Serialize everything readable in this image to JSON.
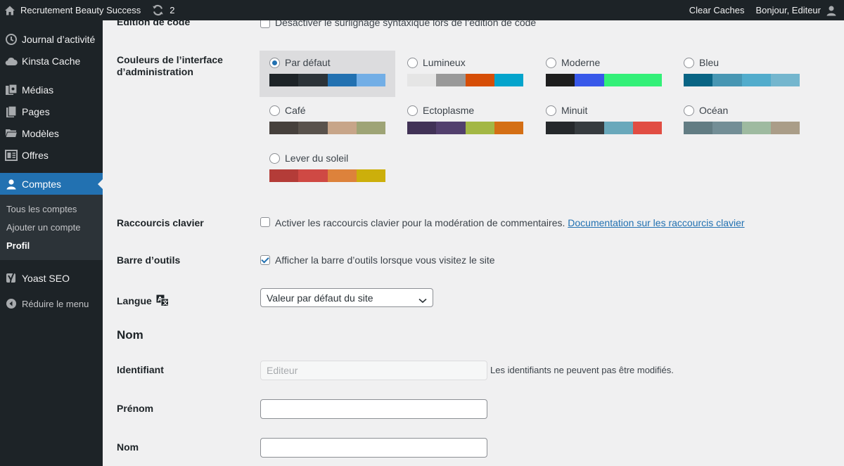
{
  "admin_bar": {
    "site_name": "Recrutement Beauty Success",
    "updates_count": "2",
    "clear_caches": "Clear Caches",
    "greeting": "Bonjour, Editeur"
  },
  "sidebar": {
    "items": [
      {
        "label": "Journal d’activité",
        "icon": "activity-log-icon"
      },
      {
        "label": "Kinsta Cache",
        "icon": "cloud-icon"
      },
      {
        "label": "Médias",
        "icon": "media-icon"
      },
      {
        "label": "Pages",
        "icon": "pages-icon"
      },
      {
        "label": "Modèles",
        "icon": "folder-icon"
      },
      {
        "label": "Offres",
        "icon": "offers-icon"
      },
      {
        "label": "Comptes",
        "icon": "user-icon"
      }
    ],
    "submenu": [
      "Tous les comptes",
      "Ajouter un compte",
      "Profil"
    ],
    "yoast": "Yoast SEO",
    "collapse": "Réduire le menu"
  },
  "form": {
    "code_edit_label": "Édition de code",
    "code_edit_checkbox": "Désactiver le surlignage syntaxique lors de l’édition de code",
    "color_scheme_label_1": "Couleurs de l’interface",
    "color_scheme_label_2": "d’administration",
    "schemes": [
      {
        "name": "Par défaut",
        "selected": true,
        "colors": [
          "#1d2327",
          "#2c3338",
          "#2271b1",
          "#72aee6"
        ]
      },
      {
        "name": "Lumineux",
        "selected": false,
        "colors": [
          "#e5e5e5",
          "#999999",
          "#d64e07",
          "#04a4cc"
        ]
      },
      {
        "name": "Moderne",
        "selected": false,
        "colors": [
          "#1e1e1e",
          "#3858e9",
          "#33f078",
          "#33f078"
        ]
      },
      {
        "name": "Bleu",
        "selected": false,
        "colors": [
          "#096484",
          "#4796b3",
          "#52accc",
          "#74b6ce"
        ]
      },
      {
        "name": "Café",
        "selected": false,
        "colors": [
          "#46403c",
          "#59524c",
          "#c7a589",
          "#9ea476"
        ]
      },
      {
        "name": "Ectoplasme",
        "selected": false,
        "colors": [
          "#413256",
          "#523f6d",
          "#a3b745",
          "#d46f15"
        ]
      },
      {
        "name": "Minuit",
        "selected": false,
        "colors": [
          "#25282b",
          "#363b3f",
          "#69a8bb",
          "#e14d43"
        ]
      },
      {
        "name": "Océan",
        "selected": false,
        "colors": [
          "#627c83",
          "#738e96",
          "#9ebaa0",
          "#aa9d88"
        ]
      },
      {
        "name": "Lever du soleil",
        "selected": false,
        "colors": [
          "#b43c38",
          "#cf4944",
          "#dd823b",
          "#ccaf0b"
        ]
      }
    ],
    "shortcuts_label": "Raccourcis clavier",
    "shortcuts_checkbox": "Activer les raccourcis clavier pour la modération de commentaires.",
    "shortcuts_link": "Documentation sur les raccourcis clavier",
    "toolbar_label": "Barre d’outils",
    "toolbar_checkbox": "Afficher la barre d’outils lorsque vous visitez le site",
    "language_label": "Langue",
    "language_value": "Valeur par défaut du site",
    "name_heading": "Nom",
    "username_label": "Identifiant",
    "username_value": "Editeur",
    "username_desc": "Les identifiants ne peuvent pas être modifiés.",
    "firstname_label": "Prénom",
    "firstname_value": "",
    "lastname_label": "Nom",
    "lastname_value": ""
  }
}
